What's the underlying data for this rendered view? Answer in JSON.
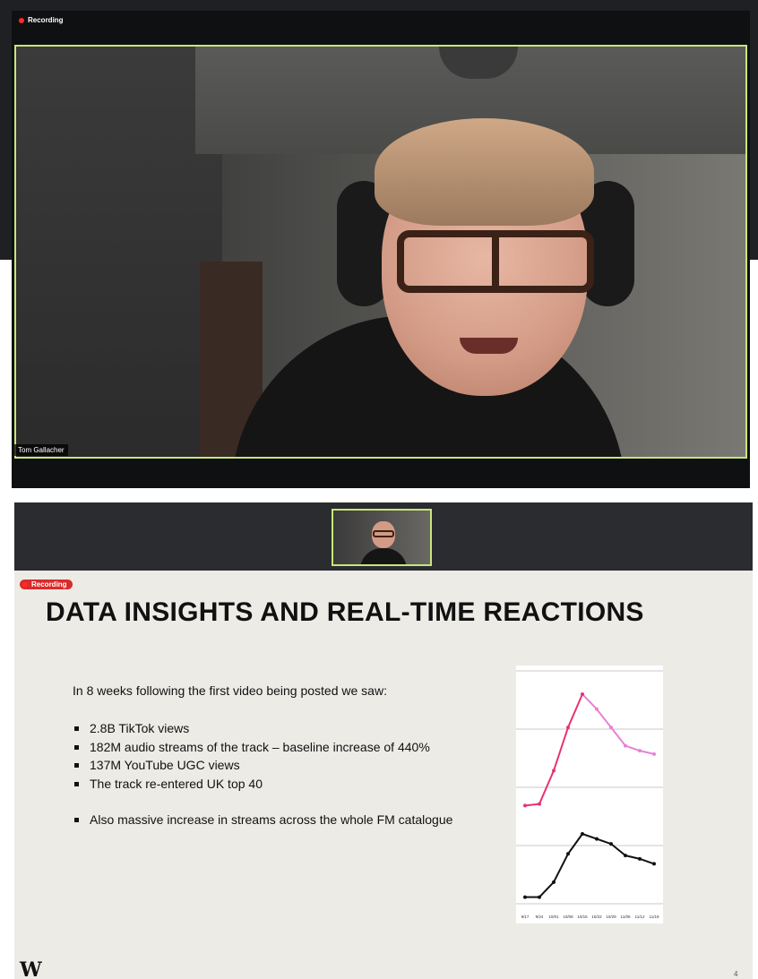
{
  "top_window": {
    "recording_label": "Recording",
    "speaker_name": "Tom Gallacher"
  },
  "share_window": {
    "recording_label": "Recording",
    "slide": {
      "title": "DATA INSIGHTS AND REAL-TIME REACTIONS",
      "intro": "In 8 weeks following the first video being posted we saw:",
      "bullets": [
        "2.8B TikTok views",
        "182M audio streams of the track – baseline increase of 440%",
        "137M YouTube UGC views",
        "The track re-entered UK top 40"
      ],
      "extra_bullet": "Also massive increase in streams across the whole FM catalogue",
      "page_number": "4",
      "logo": "W"
    }
  },
  "chart_data": {
    "type": "line",
    "x": [
      "9/17",
      "9/24",
      "10/01",
      "10/08",
      "10/15",
      "10/22",
      "10/29",
      "11/05",
      "11/12",
      "11/19"
    ],
    "series": [
      {
        "color": "#e8336f",
        "fade_color": "#e683d6",
        "values": [
          0.59,
          0.6,
          0.8,
          1.06,
          1.26,
          1.17,
          1.06,
          0.95,
          0.92,
          0.9
        ]
      },
      {
        "color": "#111111",
        "values": [
          0.04,
          0.04,
          0.13,
          0.3,
          0.42,
          0.39,
          0.36,
          0.29,
          0.27,
          0.24
        ]
      }
    ],
    "ylim": [
      0,
      1.4
    ],
    "grid": true,
    "yticks_shown": false
  }
}
